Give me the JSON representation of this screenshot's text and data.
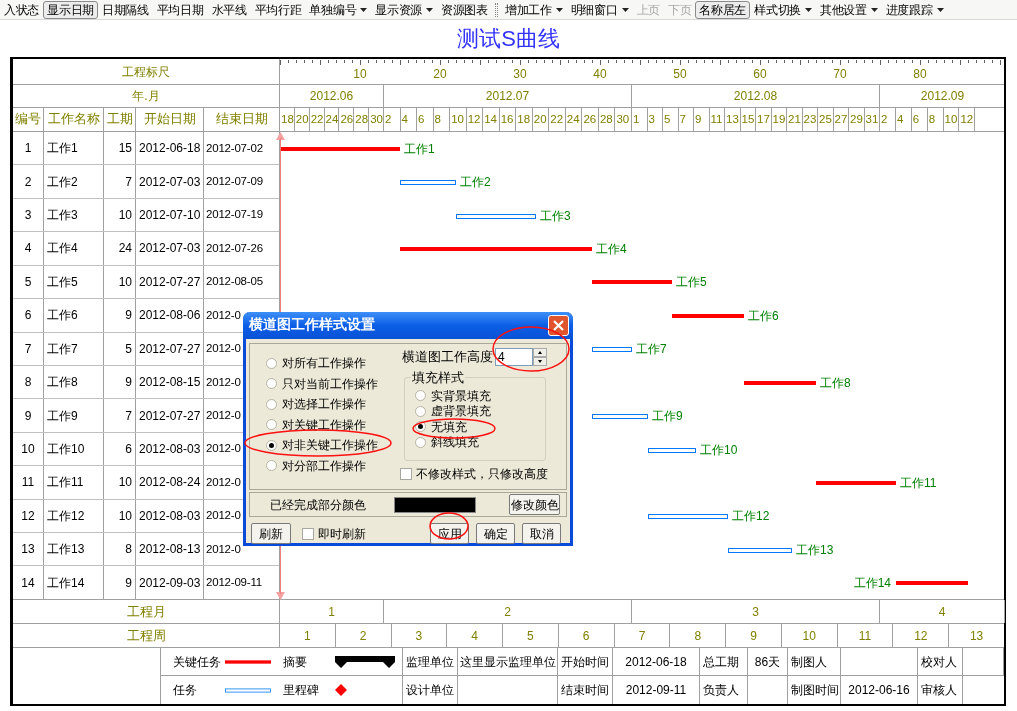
{
  "toolbar": [
    {
      "kind": "button",
      "label": "入状态",
      "pressed": false,
      "disabled": false,
      "dropdown": false
    },
    {
      "kind": "button",
      "label": "显示日期",
      "pressed": true,
      "disabled": false,
      "dropdown": false
    },
    {
      "kind": "button",
      "label": "日期隔线",
      "pressed": false,
      "disabled": false,
      "dropdown": false
    },
    {
      "kind": "button",
      "label": "平均日期",
      "pressed": false,
      "disabled": false,
      "dropdown": false
    },
    {
      "kind": "button",
      "label": "水平线",
      "pressed": false,
      "disabled": false,
      "dropdown": false
    },
    {
      "kind": "button",
      "label": "平均行距",
      "pressed": false,
      "disabled": false,
      "dropdown": false
    },
    {
      "kind": "button",
      "label": "单独编号",
      "pressed": false,
      "disabled": false,
      "dropdown": true
    },
    {
      "kind": "button",
      "label": "显示资源",
      "pressed": false,
      "disabled": false,
      "dropdown": true
    },
    {
      "kind": "button",
      "label": "资源图表",
      "pressed": false,
      "disabled": false,
      "dropdown": false
    },
    {
      "kind": "separator"
    },
    {
      "kind": "button",
      "label": "增加工作",
      "pressed": false,
      "disabled": false,
      "dropdown": true
    },
    {
      "kind": "button",
      "label": "明细窗口",
      "pressed": false,
      "disabled": false,
      "dropdown": true
    },
    {
      "kind": "button",
      "label": "上页",
      "pressed": false,
      "disabled": true,
      "dropdown": false
    },
    {
      "kind": "button",
      "label": "下页",
      "pressed": false,
      "disabled": true,
      "dropdown": false
    },
    {
      "kind": "button",
      "label": "名称居左",
      "pressed": true,
      "disabled": false,
      "dropdown": false
    },
    {
      "kind": "button",
      "label": "样式切换",
      "pressed": false,
      "disabled": false,
      "dropdown": true
    },
    {
      "kind": "button",
      "label": "其他设置",
      "pressed": false,
      "disabled": false,
      "dropdown": true
    },
    {
      "kind": "button",
      "label": "进度跟踪",
      "pressed": false,
      "disabled": false,
      "dropdown": true
    }
  ],
  "title": "测试S曲线",
  "ruler": {
    "label": "工程标尺",
    "marks": [
      "10",
      "20",
      "30",
      "40",
      "50",
      "60",
      "70",
      "80"
    ]
  },
  "month_header": {
    "label": "年.月",
    "months": [
      {
        "label": "2012.06",
        "days": [
          "18",
          "20",
          "22",
          "24",
          "26",
          "28",
          "30"
        ]
      },
      {
        "label": "2012.07",
        "days": [
          "2",
          "4",
          "6",
          "8",
          "10",
          "12",
          "14",
          "16",
          "18",
          "20",
          "22",
          "24",
          "26",
          "28",
          "30"
        ]
      },
      {
        "label": "2012.08",
        "days": [
          "1",
          "3",
          "5",
          "7",
          "9",
          "11",
          "13",
          "15",
          "17",
          "19",
          "21",
          "23",
          "25",
          "27",
          "29",
          "31"
        ]
      },
      {
        "label": "2012.09",
        "days": [
          "2",
          "4",
          "6",
          "8",
          "10",
          "12"
        ]
      }
    ]
  },
  "columns": [
    "编号",
    "工作名称",
    "工期",
    "开始日期",
    "结束日期"
  ],
  "tasks": [
    {
      "no": "1",
      "name": "工作1",
      "duration": "15",
      "start": "2012-06-18",
      "end": "2012-07-02",
      "kind": "critical",
      "bar_label": "工作1"
    },
    {
      "no": "2",
      "name": "工作2",
      "duration": "7",
      "start": "2012-07-03",
      "end": "2012-07-09",
      "kind": "normal",
      "bar_label": "工作2"
    },
    {
      "no": "3",
      "name": "工作3",
      "duration": "10",
      "start": "2012-07-10",
      "end": "2012-07-19",
      "kind": "normal",
      "bar_label": "工作3"
    },
    {
      "no": "4",
      "name": "工作4",
      "duration": "24",
      "start": "2012-07-03",
      "end": "2012-07-26",
      "kind": "critical",
      "bar_label": "工作4"
    },
    {
      "no": "5",
      "name": "工作5",
      "duration": "10",
      "start": "2012-07-27",
      "end": "2012-08-05",
      "kind": "critical",
      "bar_label": "工作5"
    },
    {
      "no": "6",
      "name": "工作6",
      "duration": "9",
      "start": "2012-08-06",
      "end": "2012-0",
      "kind": "critical",
      "bar_label": "工作6"
    },
    {
      "no": "7",
      "name": "工作7",
      "duration": "5",
      "start": "2012-07-27",
      "end": "2012-0",
      "kind": "normal",
      "bar_label": "工作7"
    },
    {
      "no": "8",
      "name": "工作8",
      "duration": "9",
      "start": "2012-08-15",
      "end": "2012-0",
      "kind": "critical",
      "bar_label": "工作8"
    },
    {
      "no": "9",
      "name": "工作9",
      "duration": "7",
      "start": "2012-07-27",
      "end": "2012-0",
      "kind": "normal",
      "bar_label": "工作9"
    },
    {
      "no": "10",
      "name": "工作10",
      "duration": "6",
      "start": "2012-08-03",
      "end": "2012-0",
      "kind": "normal",
      "bar_label": "工作10"
    },
    {
      "no": "11",
      "name": "工作11",
      "duration": "10",
      "start": "2012-08-24",
      "end": "2012-0",
      "kind": "critical",
      "bar_label": "工作11"
    },
    {
      "no": "12",
      "name": "工作12",
      "duration": "10",
      "start": "2012-08-03",
      "end": "2012-0",
      "kind": "normal",
      "bar_label": "工作12"
    },
    {
      "no": "13",
      "name": "工作13",
      "duration": "8",
      "start": "2012-08-13",
      "end": "2012-0",
      "kind": "normal",
      "bar_label": "工作13"
    },
    {
      "no": "14",
      "name": "工作14",
      "duration": "9",
      "start": "2012-09-03",
      "end": "2012-09-11",
      "kind": "critical",
      "bar_label": "工作14"
    }
  ],
  "project_months": {
    "label": "工程月",
    "values": [
      "1",
      "2",
      "3",
      "4"
    ]
  },
  "project_weeks": {
    "label": "工程周",
    "values": [
      "1",
      "2",
      "3",
      "4",
      "5",
      "6",
      "7",
      "8",
      "9",
      "10",
      "11",
      "12",
      "13"
    ]
  },
  "legend": [
    {
      "kind": "critical",
      "label": "关键任务"
    },
    {
      "kind": "summary",
      "label": "摘要"
    },
    {
      "kind": "normal",
      "label": "任务"
    },
    {
      "kind": "milestone",
      "label": "里程碑"
    }
  ],
  "info_rows": [
    [
      {
        "label": "监理单位",
        "value": "这里显示监理单位"
      },
      {
        "label": "开始时间",
        "value": "2012-06-18"
      },
      {
        "label": "总工期",
        "value": "86天"
      },
      {
        "label": "制图人"
      },
      {
        "label": "校对人"
      }
    ],
    [
      {
        "label": "设计单位"
      },
      {
        "label": "结束时间",
        "value": "2012-09-11"
      },
      {
        "label": "负责人"
      },
      {
        "label": "制图时间",
        "value": "2012-06-16"
      },
      {
        "label": "审核人"
      }
    ]
  ],
  "dialog": {
    "title": "横道图工作样式设置",
    "scope_options": [
      {
        "label": "对所有工作操作",
        "selected": false
      },
      {
        "label": "只对当前工作操作",
        "selected": false
      },
      {
        "label": "对选择工作操作",
        "selected": false
      },
      {
        "label": "对关键工作操作",
        "selected": false
      },
      {
        "label": "对非关键工作操作",
        "selected": true
      },
      {
        "label": "对分部工作操作",
        "selected": false
      }
    ],
    "height": {
      "label": "横道图工作高度",
      "value": "4"
    },
    "fill_style": {
      "title": "填充样式",
      "options": [
        {
          "label": "实背景填充",
          "selected": false
        },
        {
          "label": "虚背景填充",
          "selected": false
        },
        {
          "label": "无填充",
          "selected": true
        },
        {
          "label": "斜线填充",
          "selected": false
        }
      ]
    },
    "height_only": {
      "label": "不修改样式，只修改高度",
      "checked": false
    },
    "done_color": {
      "label": "已经完成部分颜色",
      "color": "#000000"
    },
    "change_color_button": "修改颜色",
    "refresh_button": "刷新",
    "instant_refresh": {
      "label": "即时刷新",
      "checked": false
    },
    "buttons": [
      "应用",
      "确定",
      "取消"
    ]
  }
}
